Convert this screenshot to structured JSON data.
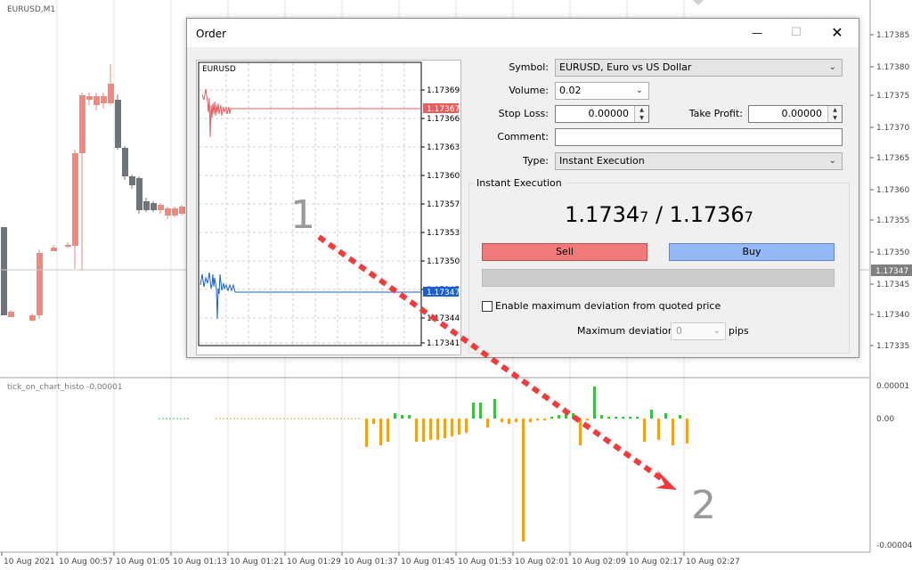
{
  "chart": {
    "symbol_label": "EURUSD,M1",
    "indicator_label": "tick_on_chart_histo -0.00001",
    "price_labels": [
      "1.17385",
      "1.17380",
      "1.17375",
      "1.17370",
      "1.17365",
      "1.17360",
      "1.17355",
      "1.17350",
      "1.17345",
      "1.17340",
      "1.17335"
    ],
    "current_price": "1.17347",
    "indicator_levels": [
      "0.00001",
      "0.00",
      "-0.00004"
    ],
    "time_labels": [
      "10 Aug 2021",
      "10 Aug 00:57",
      "10 Aug 01:05",
      "10 Aug 01:13",
      "10 Aug 01:21",
      "10 Aug 01:29",
      "10 Aug 01:37",
      "10 Aug 01:45",
      "10 Aug 01:53",
      "10 Aug 02:01",
      "10 Aug 02:09",
      "10 Aug 02:17",
      "10 Aug 02:27"
    ],
    "bull_color": "#f08a7e",
    "bear_color": "#6e7479",
    "histo_up_color": "#3cc040",
    "histo_down_color": "#f4a21e"
  },
  "order": {
    "title": "Order",
    "minimize_icon": "—",
    "maximize_icon": "☐",
    "close_icon": "✕",
    "tick_chart": {
      "symbol": "EURUSD",
      "price_labels": [
        "1.17369",
        "1.17366",
        "1.17363",
        "1.17360",
        "1.17357",
        "1.17353",
        "1.17350",
        "1.17347",
        "1.17344",
        "1.17341"
      ],
      "ask_tag": "1.17367",
      "bid_tag": "1.17347",
      "ask_color": "#e85c5c",
      "bid_color": "#1a5fd0"
    },
    "symbol_label": "Symbol:",
    "symbol_value": "EURUSD, Euro vs US Dollar",
    "volume_label": "Volume:",
    "volume_value": "0.02",
    "stop_loss_label": "Stop Loss:",
    "stop_loss_value": "0.00000",
    "take_profit_label": "Take Profit:",
    "take_profit_value": "0.00000",
    "comment_label": "Comment:",
    "comment_value": "",
    "type_label": "Type:",
    "type_value": "Instant Execution",
    "group_title": "Instant Execution",
    "bid_main": "1.1734",
    "bid_last": "7",
    "separator": " / ",
    "ask_main": "1.1736",
    "ask_last": "7",
    "sell_label": "Sell",
    "buy_label": "Buy",
    "deviation_checkbox_label": "Enable maximum deviation from quoted price",
    "max_deviation_label": "Maximum deviation:",
    "max_deviation_value": "0",
    "pips_label": "pips"
  },
  "annotations": {
    "start_label": "1",
    "end_label": "2",
    "arrow_color": "#f03c3c"
  }
}
